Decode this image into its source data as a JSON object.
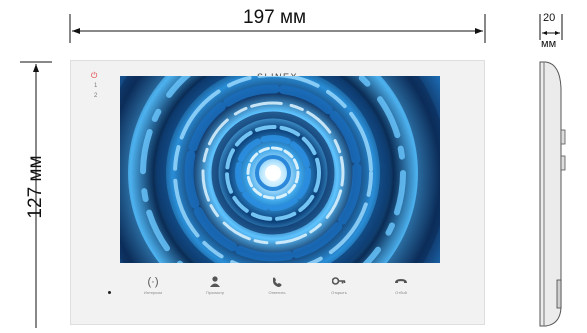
{
  "dimensions": {
    "width": "197 мм",
    "height": "127 мм",
    "depth_top": "20",
    "depth_bottom": "мм"
  },
  "device": {
    "brand": "SLINEX",
    "side_indicators": [
      "1",
      "2"
    ],
    "buttons": [
      {
        "icon": "intercom-icon",
        "label": "Интерком"
      },
      {
        "icon": "person-icon",
        "label": "Просмотр"
      },
      {
        "icon": "handset-answer-icon",
        "label": "Ответить"
      },
      {
        "icon": "key-icon",
        "label": "Открыть"
      },
      {
        "icon": "handset-hangup-icon",
        "label": "Отбой"
      }
    ]
  },
  "colors": {
    "power_indicator": "#e03030",
    "panel": "#f2f2f2"
  }
}
